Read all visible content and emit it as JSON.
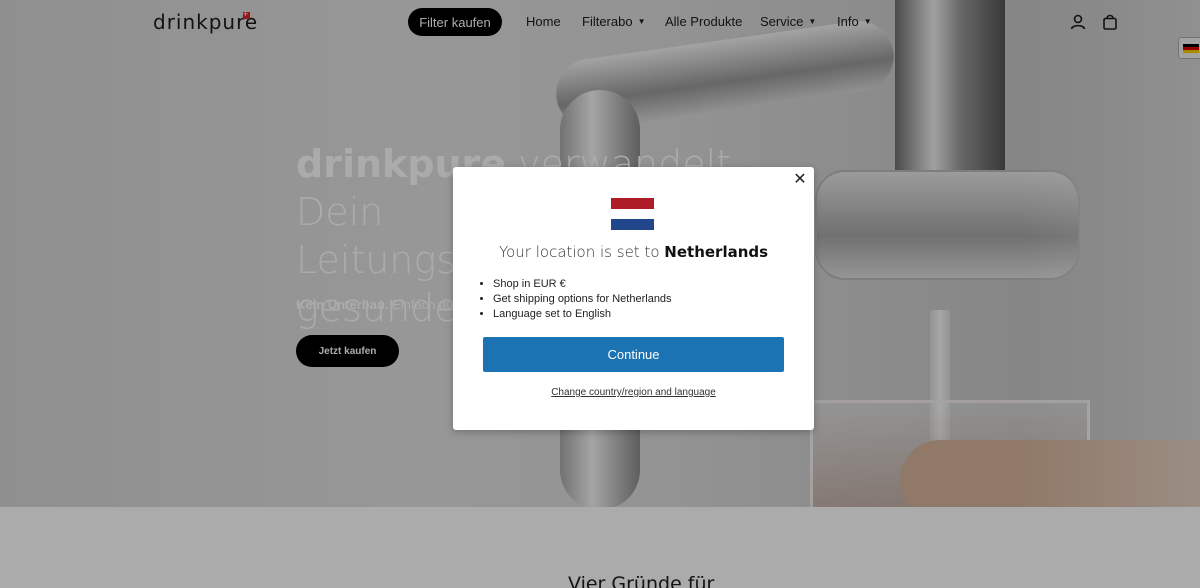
{
  "header": {
    "logo": "drinkpure",
    "cta_label": "Filter kaufen",
    "nav": [
      {
        "label": "Home",
        "dropdown": false
      },
      {
        "label": "Filterabo",
        "dropdown": true
      },
      {
        "label": "Alle Produkte",
        "dropdown": false
      },
      {
        "label": "Service",
        "dropdown": true
      },
      {
        "label": "Info",
        "dropdown": true
      }
    ],
    "icons": [
      "account-icon",
      "cart-icon"
    ]
  },
  "hero": {
    "title_bold": "drinkpure",
    "title_rest": " verwandelt Dein",
    "title_line2": "Leitungsw",
    "title_line3": "gesundes",
    "sub_bold": "Kein Unterbau.",
    "sub_rest": " Einfach auf d",
    "button_label": "Jetzt kaufen"
  },
  "lower": {
    "title": "Vier Gründe für"
  },
  "modal": {
    "title_prefix": "Your location is set to ",
    "country": "Netherlands",
    "items": [
      "Shop in EUR €",
      "Get shipping options for Netherlands",
      "Language set to English"
    ],
    "continue_label": "Continue",
    "change_label": "Change country/region and language",
    "close_symbol": "✕",
    "flag_colors": [
      "#ae1c28",
      "#ffffff",
      "#21468b"
    ]
  },
  "language_flag_colors": [
    "#000000",
    "#dd0000",
    "#ffce00"
  ],
  "colors": {
    "accent": "#1c73b4",
    "dark_button": "#000000"
  }
}
